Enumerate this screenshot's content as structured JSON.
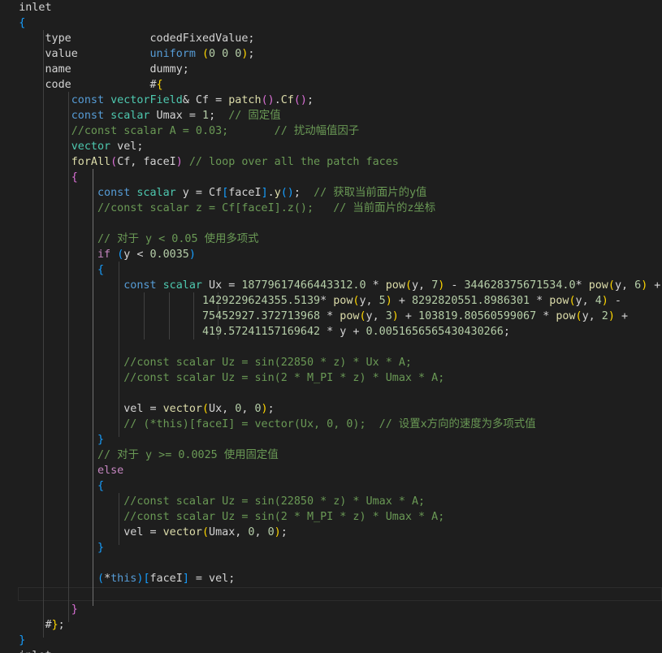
{
  "colors": {
    "background": "#1e1e1e",
    "keyword": "#569cd6",
    "control": "#c586c0",
    "type": "#4ec9b0",
    "function": "#dcdcaa",
    "variable": "#9cdcfe",
    "number": "#b5cea8",
    "comment": "#6a9955",
    "text": "#d4d4d4",
    "bracket1": "#ffd700",
    "bracket2": "#da70d6",
    "bracket3": "#179fff"
  },
  "editor": {
    "current_line": 38,
    "lines": [
      [
        [
          "txt",
          "    inlet"
        ]
      ],
      [
        [
          "b3",
          "    {"
        ]
      ],
      [
        [
          "txt",
          "        type            codedFixedValue;"
        ]
      ],
      [
        [
          "txt",
          "        value           "
        ],
        [
          "kw",
          "uniform"
        ],
        [
          "txt",
          " "
        ],
        [
          "b1",
          "("
        ],
        [
          "num",
          "0 0 0"
        ],
        [
          "b1",
          ")"
        ],
        [
          "txt",
          ";"
        ]
      ],
      [
        [
          "txt",
          "        name            dummy;"
        ]
      ],
      [
        [
          "txt",
          "        code            #"
        ],
        [
          "b1",
          "{"
        ]
      ],
      [
        [
          "txt",
          "            "
        ],
        [
          "kw",
          "const"
        ],
        [
          "txt",
          " "
        ],
        [
          "ty",
          "vectorField"
        ],
        [
          "txt",
          "& Cf = "
        ],
        [
          "fn",
          "patch"
        ],
        [
          "b2",
          "()"
        ],
        [
          "txt",
          "."
        ],
        [
          "fn",
          "Cf"
        ],
        [
          "b2",
          "()"
        ],
        [
          "txt",
          ";"
        ]
      ],
      [
        [
          "txt",
          "            "
        ],
        [
          "kw",
          "const"
        ],
        [
          "txt",
          " "
        ],
        [
          "ty",
          "scalar"
        ],
        [
          "txt",
          " Umax = "
        ],
        [
          "num",
          "1"
        ],
        [
          "txt",
          ";  "
        ],
        [
          "cm",
          "// 固定值"
        ]
      ],
      [
        [
          "cm",
          "            //const scalar A = 0.03;       // 扰动幅值因子"
        ]
      ],
      [
        [
          "txt",
          "            "
        ],
        [
          "ty",
          "vector"
        ],
        [
          "txt",
          " vel;"
        ]
      ],
      [
        [
          "txt",
          "            "
        ],
        [
          "fn",
          "forAll"
        ],
        [
          "b2",
          "("
        ],
        [
          "txt",
          "Cf, faceI"
        ],
        [
          "b2",
          ")"
        ],
        [
          "txt",
          " "
        ],
        [
          "cm",
          "// loop over all the patch faces"
        ]
      ],
      [
        [
          "txt",
          "            "
        ],
        [
          "b2",
          "{"
        ]
      ],
      [
        [
          "txt",
          "                "
        ],
        [
          "kw",
          "const"
        ],
        [
          "txt",
          " "
        ],
        [
          "ty",
          "scalar"
        ],
        [
          "txt",
          " y = Cf"
        ],
        [
          "b3",
          "["
        ],
        [
          "txt",
          "faceI"
        ],
        [
          "b3",
          "]"
        ],
        [
          "txt",
          "."
        ],
        [
          "fn",
          "y"
        ],
        [
          "b3",
          "()"
        ],
        [
          "txt",
          ";  "
        ],
        [
          "cm",
          "// 获取当前面片的y值"
        ]
      ],
      [
        [
          "cm",
          "                //const scalar z = Cf[faceI].z();   // 当前面片的z坐标"
        ]
      ],
      [
        [
          "txt",
          ""
        ]
      ],
      [
        [
          "cm",
          "                // 对于 y < 0.05 使用多项式"
        ]
      ],
      [
        [
          "txt",
          "                "
        ],
        [
          "ctl",
          "if"
        ],
        [
          "txt",
          " "
        ],
        [
          "b3",
          "("
        ],
        [
          "txt",
          "y < "
        ],
        [
          "num",
          "0.0035"
        ],
        [
          "b3",
          ")"
        ]
      ],
      [
        [
          "txt",
          "                "
        ],
        [
          "b3",
          "{"
        ]
      ],
      [
        [
          "txt",
          "                    "
        ],
        [
          "kw",
          "const"
        ],
        [
          "txt",
          " "
        ],
        [
          "ty",
          "scalar"
        ],
        [
          "txt",
          " Ux = "
        ],
        [
          "num",
          "18779617466443312.0"
        ],
        [
          "txt",
          " * "
        ],
        [
          "fn",
          "pow"
        ],
        [
          "b1",
          "("
        ],
        [
          "txt",
          "y, "
        ],
        [
          "num",
          "7"
        ],
        [
          "b1",
          ")"
        ],
        [
          "txt",
          " - "
        ],
        [
          "num",
          "344628375671534.0"
        ],
        [
          "txt",
          "* "
        ],
        [
          "fn",
          "pow"
        ],
        [
          "b1",
          "("
        ],
        [
          "txt",
          "y, "
        ],
        [
          "num",
          "6"
        ],
        [
          "b1",
          ")"
        ],
        [
          "txt",
          " +"
        ]
      ],
      [
        [
          "txt",
          "                                "
        ],
        [
          "num",
          "1429229624355.5139"
        ],
        [
          "txt",
          "* "
        ],
        [
          "fn",
          "pow"
        ],
        [
          "b1",
          "("
        ],
        [
          "txt",
          "y, "
        ],
        [
          "num",
          "5"
        ],
        [
          "b1",
          ")"
        ],
        [
          "txt",
          " + "
        ],
        [
          "num",
          "8292820551.8986301"
        ],
        [
          "txt",
          " * "
        ],
        [
          "fn",
          "pow"
        ],
        [
          "b1",
          "("
        ],
        [
          "txt",
          "y, "
        ],
        [
          "num",
          "4"
        ],
        [
          "b1",
          ")"
        ],
        [
          "txt",
          " -"
        ]
      ],
      [
        [
          "txt",
          "                                "
        ],
        [
          "num",
          "75452927.372713968"
        ],
        [
          "txt",
          " * "
        ],
        [
          "fn",
          "pow"
        ],
        [
          "b1",
          "("
        ],
        [
          "txt",
          "y, "
        ],
        [
          "num",
          "3"
        ],
        [
          "b1",
          ")"
        ],
        [
          "txt",
          " + "
        ],
        [
          "num",
          "103819.80560599067"
        ],
        [
          "txt",
          " * "
        ],
        [
          "fn",
          "pow"
        ],
        [
          "b1",
          "("
        ],
        [
          "txt",
          "y, "
        ],
        [
          "num",
          "2"
        ],
        [
          "b1",
          ")"
        ],
        [
          "txt",
          " +"
        ]
      ],
      [
        [
          "txt",
          "                                "
        ],
        [
          "num",
          "419.57241157169642"
        ],
        [
          "txt",
          " * y + "
        ],
        [
          "num",
          "0.0051656565430430266"
        ],
        [
          "txt",
          ";"
        ]
      ],
      [
        [
          "txt",
          ""
        ]
      ],
      [
        [
          "cm",
          "                    //const scalar Uz = sin(22850 * z) * Ux * A;"
        ]
      ],
      [
        [
          "cm",
          "                    //const scalar Uz = sin(2 * M_PI * z) * Umax * A;"
        ]
      ],
      [
        [
          "txt",
          ""
        ]
      ],
      [
        [
          "txt",
          "                    vel = "
        ],
        [
          "fn",
          "vector"
        ],
        [
          "b1",
          "("
        ],
        [
          "txt",
          "Ux, "
        ],
        [
          "num",
          "0"
        ],
        [
          "txt",
          ", "
        ],
        [
          "num",
          "0"
        ],
        [
          "b1",
          ")"
        ],
        [
          "txt",
          ";"
        ]
      ],
      [
        [
          "cm",
          "                    // (*this)[faceI] = vector(Ux, 0, 0);  // 设置x方向的速度为多项式值"
        ]
      ],
      [
        [
          "txt",
          "                "
        ],
        [
          "b3",
          "}"
        ]
      ],
      [
        [
          "cm",
          "                // 对于 y >= 0.0025 使用固定值"
        ]
      ],
      [
        [
          "txt",
          "                "
        ],
        [
          "ctl",
          "else"
        ]
      ],
      [
        [
          "txt",
          "                "
        ],
        [
          "b3",
          "{"
        ]
      ],
      [
        [
          "cm",
          "                    //const scalar Uz = sin(22850 * z) * Umax * A;"
        ]
      ],
      [
        [
          "cm",
          "                    //const scalar Uz = sin(2 * M_PI * z) * Umax * A;"
        ]
      ],
      [
        [
          "txt",
          "                    vel = "
        ],
        [
          "fn",
          "vector"
        ],
        [
          "b1",
          "("
        ],
        [
          "txt",
          "Umax, "
        ],
        [
          "num",
          "0"
        ],
        [
          "txt",
          ", "
        ],
        [
          "num",
          "0"
        ],
        [
          "b1",
          ")"
        ],
        [
          "txt",
          ";"
        ]
      ],
      [
        [
          "txt",
          "                "
        ],
        [
          "b3",
          "}"
        ]
      ],
      [
        [
          "txt",
          ""
        ]
      ],
      [
        [
          "txt",
          "                "
        ],
        [
          "b3",
          "("
        ],
        [
          "txt",
          "*"
        ],
        [
          "kw",
          "this"
        ],
        [
          "b3",
          ")"
        ],
        [
          "b3",
          "["
        ],
        [
          "txt",
          "faceI"
        ],
        [
          "b3",
          "]"
        ],
        [
          "txt",
          " = vel;"
        ]
      ],
      [
        [
          "txt",
          ""
        ]
      ],
      [
        [
          "txt",
          "            "
        ],
        [
          "b2",
          "}"
        ]
      ],
      [
        [
          "txt",
          "        #"
        ],
        [
          "b1",
          "}"
        ],
        [
          "txt",
          ";"
        ]
      ],
      [
        [
          "b3",
          "    }"
        ]
      ],
      [
        [
          "txt",
          "    inlet"
        ]
      ]
    ]
  }
}
